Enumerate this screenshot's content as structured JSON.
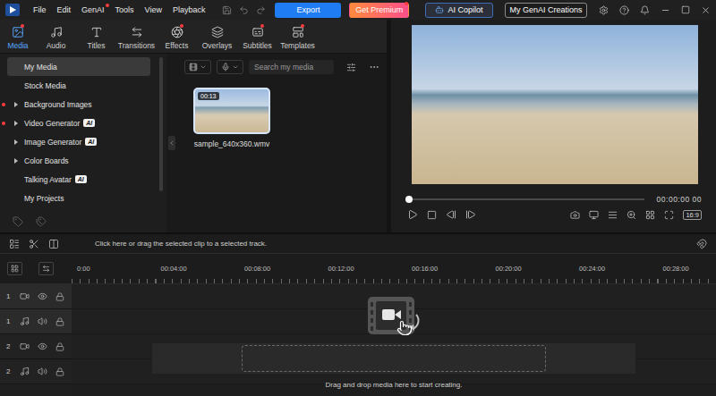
{
  "menu": {
    "items": [
      {
        "label": "File",
        "new": false
      },
      {
        "label": "Edit",
        "new": false
      },
      {
        "label": "GenAI",
        "new": true
      },
      {
        "label": "Tools",
        "new": false
      },
      {
        "label": "View",
        "new": false
      },
      {
        "label": "Playback",
        "new": false
      }
    ]
  },
  "header_buttons": [
    {
      "label": "Export",
      "kind": "primary",
      "new": false
    },
    {
      "label": "Get Premium",
      "kind": "premium",
      "new": true
    },
    {
      "label": "AI Copilot",
      "kind": "copilot",
      "new": false
    },
    {
      "label": "My GenAI Creations",
      "kind": "outline",
      "new": false
    }
  ],
  "tabs": [
    {
      "label": "Media",
      "selected": true,
      "new": true
    },
    {
      "label": "Audio",
      "selected": false,
      "new": false
    },
    {
      "label": "Titles",
      "selected": false,
      "new": false
    },
    {
      "label": "Transitions",
      "selected": false,
      "new": false
    },
    {
      "label": "Effects",
      "selected": false,
      "new": true
    },
    {
      "label": "Overlays",
      "selected": false,
      "new": false
    },
    {
      "label": "Subtitles",
      "selected": false,
      "new": true
    },
    {
      "label": "Templates",
      "selected": false,
      "new": true
    }
  ],
  "sidebar": {
    "items": [
      {
        "label": "My Media",
        "selected": true,
        "expandable": false,
        "new": false,
        "badge": null
      },
      {
        "label": "Stock Media",
        "selected": false,
        "expandable": false,
        "new": false,
        "badge": null
      },
      {
        "label": "Background Images",
        "selected": false,
        "expandable": true,
        "new": true,
        "badge": null
      },
      {
        "label": "Video Generator",
        "selected": false,
        "expandable": true,
        "new": true,
        "badge": "AI"
      },
      {
        "label": "Image Generator",
        "selected": false,
        "expandable": true,
        "new": false,
        "badge": "AI"
      },
      {
        "label": "Color Boards",
        "selected": false,
        "expandable": true,
        "new": false,
        "badge": null
      },
      {
        "label": "Talking Avatar",
        "selected": false,
        "expandable": false,
        "new": false,
        "badge": "AI"
      },
      {
        "label": "My Projects",
        "selected": false,
        "expandable": false,
        "new": false,
        "badge": null
      }
    ]
  },
  "media_search": {
    "placeholder": "Search my media"
  },
  "media_items": [
    {
      "name": "sample_640x360.wmv",
      "duration": "00:13",
      "selected": true
    }
  ],
  "preview": {
    "timecode": "00:00:00 00",
    "level": 0,
    "aspect": "16:9"
  },
  "timeline": {
    "hint": "Click here or drag the selected clip to a selected track.",
    "ruler": [
      "0:00",
      "00:04:00",
      "00:08:00",
      "00:12:00",
      "00:16:00",
      "00:20:00",
      "00:24:00",
      "00:28:00"
    ],
    "tracks": [
      {
        "number": "1",
        "kind": "video",
        "selected": true
      },
      {
        "number": "1",
        "kind": "audio",
        "selected": true
      },
      {
        "number": "2",
        "kind": "video",
        "selected": false
      },
      {
        "number": "2",
        "kind": "audio",
        "selected": false
      }
    ],
    "drop_text": "Drag and drop media here to start creating."
  }
}
